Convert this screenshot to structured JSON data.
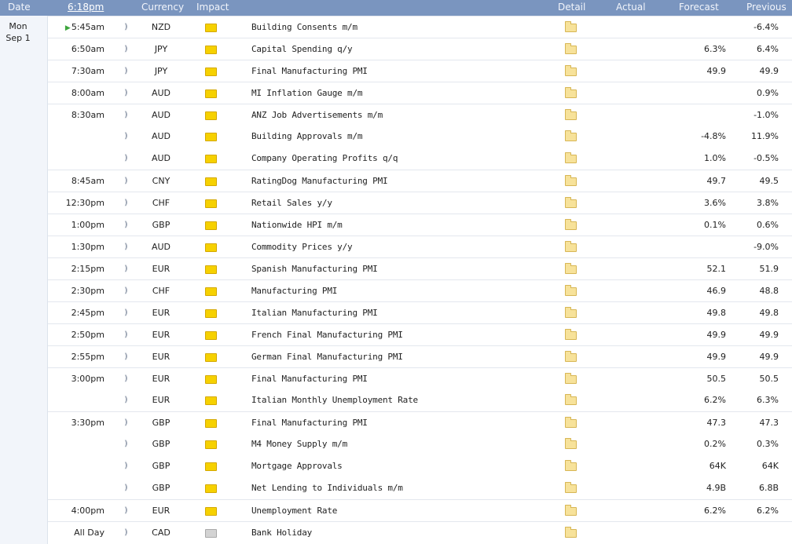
{
  "header": {
    "date": "Date",
    "time": "6:18pm",
    "currency": "Currency",
    "impact": "Impact",
    "detail": "Detail",
    "actual": "Actual",
    "forecast": "Forecast",
    "previous": "Previous"
  },
  "date_col": {
    "weekday": "Mon",
    "date": "Sep 1"
  },
  "rows": [
    {
      "time": "5:45am",
      "currency": "NZD",
      "event": "Building Consents m/m",
      "actual": "",
      "forecast": "",
      "previous": "-6.4%"
    },
    {
      "time": "6:50am",
      "currency": "JPY",
      "event": "Capital Spending q/y",
      "actual": "",
      "forecast": "6.3%",
      "previous": "6.4%"
    },
    {
      "time": "7:30am",
      "currency": "JPY",
      "event": "Final Manufacturing PMI",
      "actual": "",
      "forecast": "49.9",
      "previous": "49.9"
    },
    {
      "time": "8:00am",
      "currency": "AUD",
      "event": "MI Inflation Gauge m/m",
      "actual": "",
      "forecast": "",
      "previous": "0.9%"
    },
    {
      "time": "8:30am",
      "currency": "AUD",
      "event": "ANZ Job Advertisements m/m",
      "actual": "",
      "forecast": "",
      "previous": "-1.0%"
    },
    {
      "time": "",
      "currency": "AUD",
      "event": "Building Approvals m/m",
      "actual": "",
      "forecast": "-4.8%",
      "previous": "11.9%"
    },
    {
      "time": "",
      "currency": "AUD",
      "event": "Company Operating Profits q/q",
      "actual": "",
      "forecast": "1.0%",
      "previous": "-0.5%"
    },
    {
      "time": "8:45am",
      "currency": "CNY",
      "event": "RatingDog Manufacturing PMI",
      "actual": "",
      "forecast": "49.7",
      "previous": "49.5"
    },
    {
      "time": "12:30pm",
      "currency": "CHF",
      "event": "Retail Sales y/y",
      "actual": "",
      "forecast": "3.6%",
      "previous": "3.8%"
    },
    {
      "time": "1:00pm",
      "currency": "GBP",
      "event": "Nationwide HPI m/m",
      "actual": "",
      "forecast": "0.1%",
      "previous": "0.6%"
    },
    {
      "time": "1:30pm",
      "currency": "AUD",
      "event": "Commodity Prices y/y",
      "actual": "",
      "forecast": "",
      "previous": "-9.0%"
    },
    {
      "time": "2:15pm",
      "currency": "EUR",
      "event": "Spanish Manufacturing PMI",
      "actual": "",
      "forecast": "52.1",
      "previous": "51.9"
    },
    {
      "time": "2:30pm",
      "currency": "CHF",
      "event": "Manufacturing PMI",
      "actual": "",
      "forecast": "46.9",
      "previous": "48.8"
    },
    {
      "time": "2:45pm",
      "currency": "EUR",
      "event": "Italian Manufacturing PMI",
      "actual": "",
      "forecast": "49.8",
      "previous": "49.8"
    },
    {
      "time": "2:50pm",
      "currency": "EUR",
      "event": "French Final Manufacturing PMI",
      "actual": "",
      "forecast": "49.9",
      "previous": "49.9"
    },
    {
      "time": "2:55pm",
      "currency": "EUR",
      "event": "German Final Manufacturing PMI",
      "actual": "",
      "forecast": "49.9",
      "previous": "49.9"
    },
    {
      "time": "3:00pm",
      "currency": "EUR",
      "event": "Final Manufacturing PMI",
      "actual": "",
      "forecast": "50.5",
      "previous": "50.5"
    },
    {
      "time": "",
      "currency": "EUR",
      "event": "Italian Monthly Unemployment Rate",
      "actual": "",
      "forecast": "6.2%",
      "previous": "6.3%"
    },
    {
      "time": "3:30pm",
      "currency": "GBP",
      "event": "Final Manufacturing PMI",
      "actual": "",
      "forecast": "47.3",
      "previous": "47.3"
    },
    {
      "time": "",
      "currency": "GBP",
      "event": "M4 Money Supply m/m",
      "actual": "",
      "forecast": "0.2%",
      "previous": "0.3%"
    },
    {
      "time": "",
      "currency": "GBP",
      "event": "Mortgage Approvals",
      "actual": "",
      "forecast": "64K",
      "previous": "64K"
    },
    {
      "time": "",
      "currency": "GBP",
      "event": "Net Lending to Individuals m/m",
      "actual": "",
      "forecast": "4.9B",
      "previous": "6.8B"
    },
    {
      "time": "4:00pm",
      "currency": "EUR",
      "event": "Unemployment Rate",
      "actual": "",
      "forecast": "6.2%",
      "previous": "6.2%"
    },
    {
      "time": "All Day",
      "currency": "CAD",
      "event": "Bank Holiday",
      "actual": "",
      "forecast": "",
      "previous": ""
    }
  ],
  "icons": {
    "upcoming": "play-arrow-icon",
    "sound": "sound-icon",
    "impact": "impact-folder-icon",
    "detail": "detail-folder-icon"
  },
  "colors": {
    "header_bg": "#7a95bf",
    "impact_yellow": "#f6d100",
    "impact_gray": "#d3d3d3",
    "upcoming_green": "#3da53d"
  }
}
